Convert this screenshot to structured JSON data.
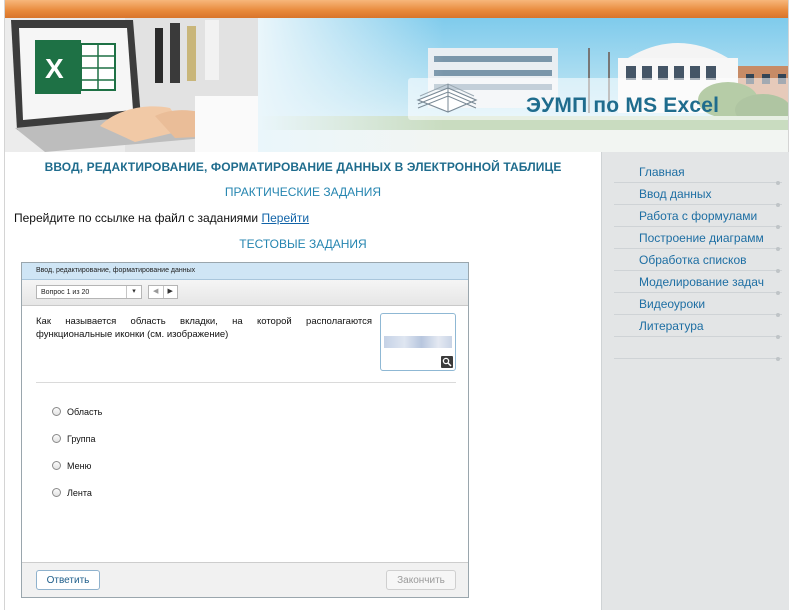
{
  "banner": {
    "title": "ЭУМП по MS Excel",
    "excel_letter": "X"
  },
  "main": {
    "heading": "ВВОД, РЕДАКТИРОВАНИЕ, ФОРМАТИРОВАНИЕ ДАННЫХ В ЭЛЕКТРОННОЙ ТАБЛИЦЕ",
    "practical_heading": "ПРАКТИЧЕСКИЕ ЗАДАНИЯ",
    "link_prefix": "Перейдите по ссылке на файл с заданиями",
    "link_text": "Перейти",
    "tests_heading": "ТЕСТОВЫЕ ЗАДАНИЯ"
  },
  "quiz": {
    "header": "Ввод, редактирование, форматирование данных",
    "question_selector": "Вопрос 1 из 20",
    "question_text": "Как называется область вкладки, на которой располагаются функциональные иконки (см. изображение)",
    "options": [
      "Область",
      "Группа",
      "Меню",
      "Лента"
    ],
    "answer_button": "Ответить",
    "finish_button": "Закончить"
  },
  "sidebar": {
    "items": [
      "Главная",
      "Ввод данных",
      "Работа с формулами",
      "Построение диаграмм",
      "Обработка списков",
      "Моделирование задач",
      "Видеоуроки",
      "Литература"
    ]
  },
  "colors": {
    "accent": "#1f6c8d",
    "orange_bar": "#e8893a",
    "sidebar_bg": "#e3e5e6"
  },
  "icons": {
    "zoom": "magnifier-icon",
    "prev": "triangle-left-icon",
    "next": "triangle-right-icon",
    "dropdown": "chevron-down-icon"
  }
}
